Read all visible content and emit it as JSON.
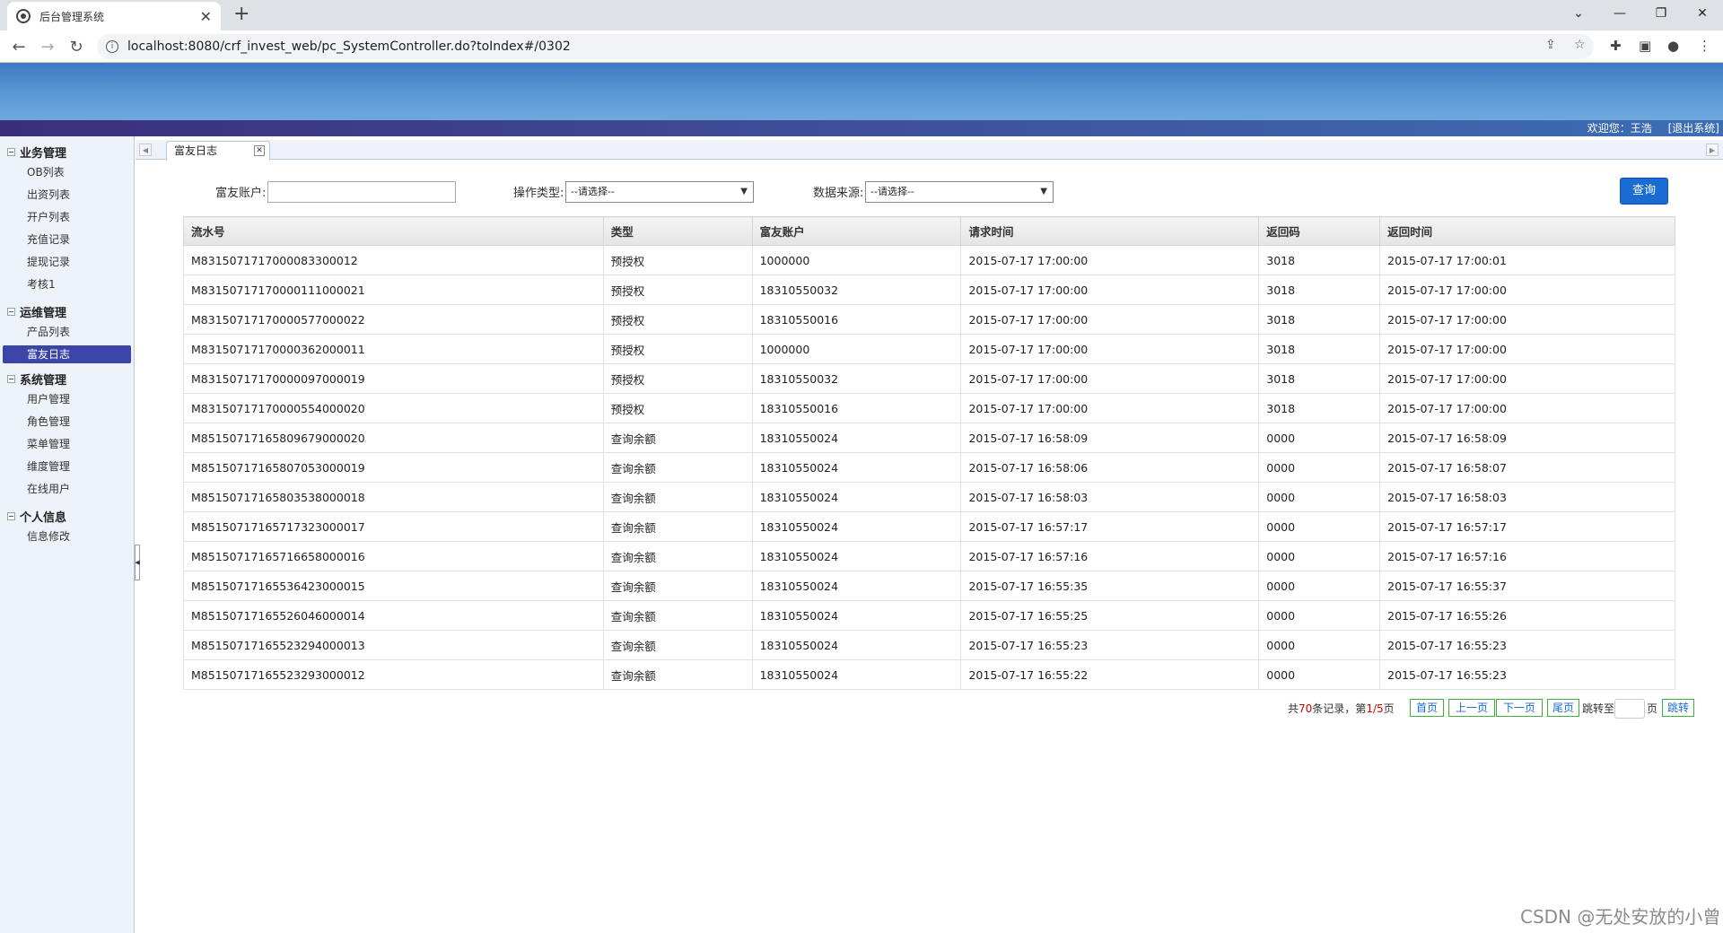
{
  "browser": {
    "tab_title": "后台管理系统",
    "url": "localhost:8080/crf_invest_web/pc_SystemController.do?toIndex#/0302"
  },
  "header": {
    "welcome": "欢迎您：王浩",
    "logout": "[退出系统]"
  },
  "sidebar": {
    "groups": [
      {
        "label": "业务管理",
        "items": [
          "OB列表",
          "出资列表",
          "开户列表",
          "充值记录",
          "提现记录",
          "考核1"
        ]
      },
      {
        "label": "运维管理",
        "items": [
          "产品列表",
          "富友日志"
        ]
      },
      {
        "label": "系统管理",
        "items": [
          "用户管理",
          "角色管理",
          "菜单管理",
          "维度管理",
          "在线用户"
        ]
      },
      {
        "label": "个人信息",
        "items": [
          "信息修改"
        ]
      }
    ],
    "active_item": "富友日志"
  },
  "content_tab": {
    "label": "富友日志"
  },
  "filters": {
    "account_label": "富友账户:",
    "account_value": "",
    "op_type_label": "操作类型:",
    "op_type_selected": "--请选择--",
    "source_label": "数据来源:",
    "source_selected": "--请选择--",
    "query_button": "查询"
  },
  "table": {
    "columns": [
      "流水号",
      "类型",
      "富友账户",
      "请求时间",
      "返回码",
      "返回时间"
    ],
    "rows": [
      [
        "M8315071717000083300012",
        "预授权",
        "1000000",
        "2015-07-17 17:00:00",
        "3018",
        "2015-07-17 17:00:01"
      ],
      [
        "M83150717170000111000021",
        "预授权",
        "18310550032",
        "2015-07-17 17:00:00",
        "3018",
        "2015-07-17 17:00:00"
      ],
      [
        "M83150717170000577000022",
        "预授权",
        "18310550016",
        "2015-07-17 17:00:00",
        "3018",
        "2015-07-17 17:00:00"
      ],
      [
        "M83150717170000362000011",
        "预授权",
        "1000000",
        "2015-07-17 17:00:00",
        "3018",
        "2015-07-17 17:00:00"
      ],
      [
        "M83150717170000097000019",
        "预授权",
        "18310550032",
        "2015-07-17 17:00:00",
        "3018",
        "2015-07-17 17:00:00"
      ],
      [
        "M83150717170000554000020",
        "预授权",
        "18310550016",
        "2015-07-17 17:00:00",
        "3018",
        "2015-07-17 17:00:00"
      ],
      [
        "M85150717165809679000020",
        "查询余额",
        "18310550024",
        "2015-07-17 16:58:09",
        "0000",
        "2015-07-17 16:58:09"
      ],
      [
        "M85150717165807053000019",
        "查询余额",
        "18310550024",
        "2015-07-17 16:58:06",
        "0000",
        "2015-07-17 16:58:07"
      ],
      [
        "M85150717165803538000018",
        "查询余额",
        "18310550024",
        "2015-07-17 16:58:03",
        "0000",
        "2015-07-17 16:58:03"
      ],
      [
        "M85150717165717323000017",
        "查询余额",
        "18310550024",
        "2015-07-17 16:57:17",
        "0000",
        "2015-07-17 16:57:17"
      ],
      [
        "M85150717165716658000016",
        "查询余额",
        "18310550024",
        "2015-07-17 16:57:16",
        "0000",
        "2015-07-17 16:57:16"
      ],
      [
        "M85150717165536423000015",
        "查询余额",
        "18310550024",
        "2015-07-17 16:55:35",
        "0000",
        "2015-07-17 16:55:37"
      ],
      [
        "M85150717165526046000014",
        "查询余额",
        "18310550024",
        "2015-07-17 16:55:25",
        "0000",
        "2015-07-17 16:55:26"
      ],
      [
        "M85150717165523294000013",
        "查询余额",
        "18310550024",
        "2015-07-17 16:55:23",
        "0000",
        "2015-07-17 16:55:23"
      ],
      [
        "M85150717165523293000012",
        "查询余额",
        "18310550024",
        "2015-07-17 16:55:22",
        "0000",
        "2015-07-17 16:55:23"
      ]
    ]
  },
  "pager": {
    "prefix": "共",
    "total": "70",
    "mid": "条记录，第",
    "current": "1/5",
    "suffix": "页",
    "first": "首页",
    "prev": "上一页",
    "next": "下一页",
    "last": "尾页",
    "jump_to": "跳转至",
    "page_unit": "页",
    "go": "跳转"
  },
  "watermark": "CSDN @无处安放的小曾"
}
